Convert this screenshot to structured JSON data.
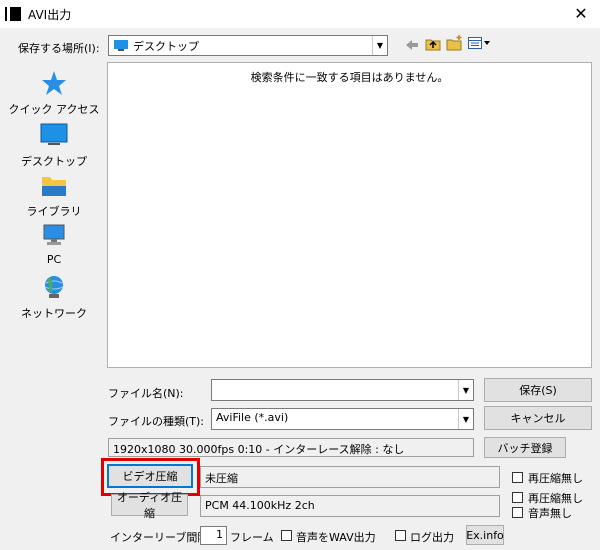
{
  "window": {
    "title": "AVI出力",
    "close_glyph": "✕"
  },
  "location": {
    "label": "保存する場所(I):",
    "value": "デスクトップ"
  },
  "places": [
    {
      "label": "クイック アクセス"
    },
    {
      "label": "デスクトップ"
    },
    {
      "label": "ライブラリ"
    },
    {
      "label": "PC"
    },
    {
      "label": "ネットワーク"
    }
  ],
  "filelist": {
    "empty_message": "検索条件に一致する項目はありません。"
  },
  "filename": {
    "label": "ファイル名(N):",
    "value": ""
  },
  "filetype": {
    "label": "ファイルの種類(T):",
    "value": "AviFile (*.avi)"
  },
  "buttons": {
    "save": "保存(S)",
    "cancel": "キャンセル",
    "batch": "バッチ登録",
    "video_compress": "ビデオ圧縮",
    "audio_compress": "オーディオ圧縮",
    "exinfo": "Ex.info"
  },
  "info_line": "1920x1080  30.000fps  0:10  -  インターレース解除 : なし",
  "video": {
    "codec": "未圧縮",
    "no_recompress": "再圧縮無し"
  },
  "audio": {
    "format": "PCM 44.100kHz 2ch",
    "no_recompress": "再圧縮無し",
    "no_audio": "音声無し"
  },
  "interleave": {
    "label": "インターリーブ間隔 :",
    "value": "1",
    "unit": "フレーム"
  },
  "options": {
    "wav_output": "音声をWAV出力",
    "log_output": "ログ出力"
  },
  "colors": {
    "accent": "#0078d7",
    "highlight": "#e00000"
  }
}
